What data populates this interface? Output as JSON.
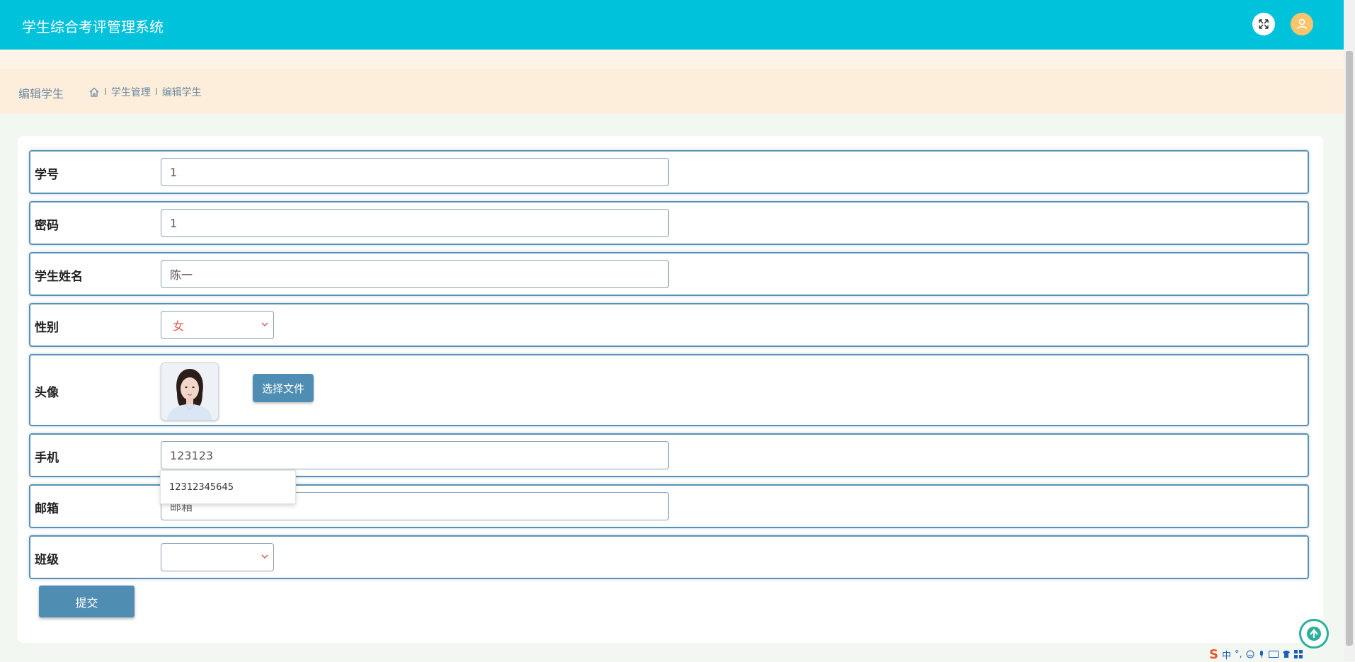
{
  "header": {
    "app_title": "学生综合考评管理系统"
  },
  "breadcrumb": {
    "page_heading": "编辑学生",
    "separator": "I",
    "items": [
      "学生管理",
      "编辑学生"
    ]
  },
  "form": {
    "student_id": {
      "label": "学号",
      "value": "1"
    },
    "password": {
      "label": "密码",
      "value": "1"
    },
    "name": {
      "label": "学生姓名",
      "value": "陈一"
    },
    "gender": {
      "label": "性别",
      "value": "女"
    },
    "avatar": {
      "label": "头像",
      "choose_button": "选择文件"
    },
    "phone": {
      "label": "手机",
      "value": "123123"
    },
    "email": {
      "label": "邮箱",
      "placeholder": "邮箱"
    },
    "class": {
      "label": "班级",
      "value": ""
    },
    "submit_label": "提交"
  },
  "autocomplete": {
    "suggestion": "12312345645"
  },
  "ime": {
    "mode": "中",
    "punct": "°,"
  },
  "colors": {
    "header_bg": "#00c2da",
    "breadcrumb_bg": "#fdeedb",
    "row_border": "#5a91b3",
    "button_bg": "#4f8db3",
    "select_text": "#e05a5a"
  }
}
